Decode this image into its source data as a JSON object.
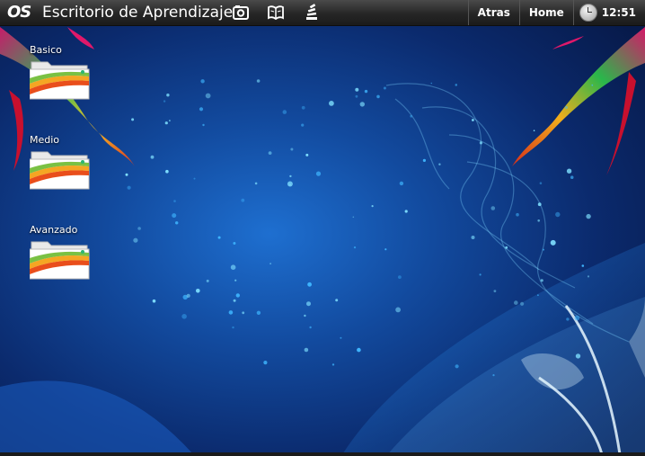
{
  "topbar": {
    "logo": "OS",
    "title": "Escritorio de Aprendizaje",
    "icons": [
      "camera-icon",
      "book-icon",
      "stack-icon"
    ],
    "back_label": "Atras",
    "home_label": "Home",
    "time": "12:51"
  },
  "desktop": {
    "items": [
      {
        "label": "Basico",
        "icon": "folder-icon"
      },
      {
        "label": "Medio",
        "icon": "folder-icon"
      },
      {
        "label": "Avanzado",
        "icon": "folder-icon"
      }
    ]
  },
  "colors": {
    "panel": "#262626",
    "wallpaper_base": "#0b2a6d",
    "wallpaper_glow": "#1e6fd0"
  }
}
